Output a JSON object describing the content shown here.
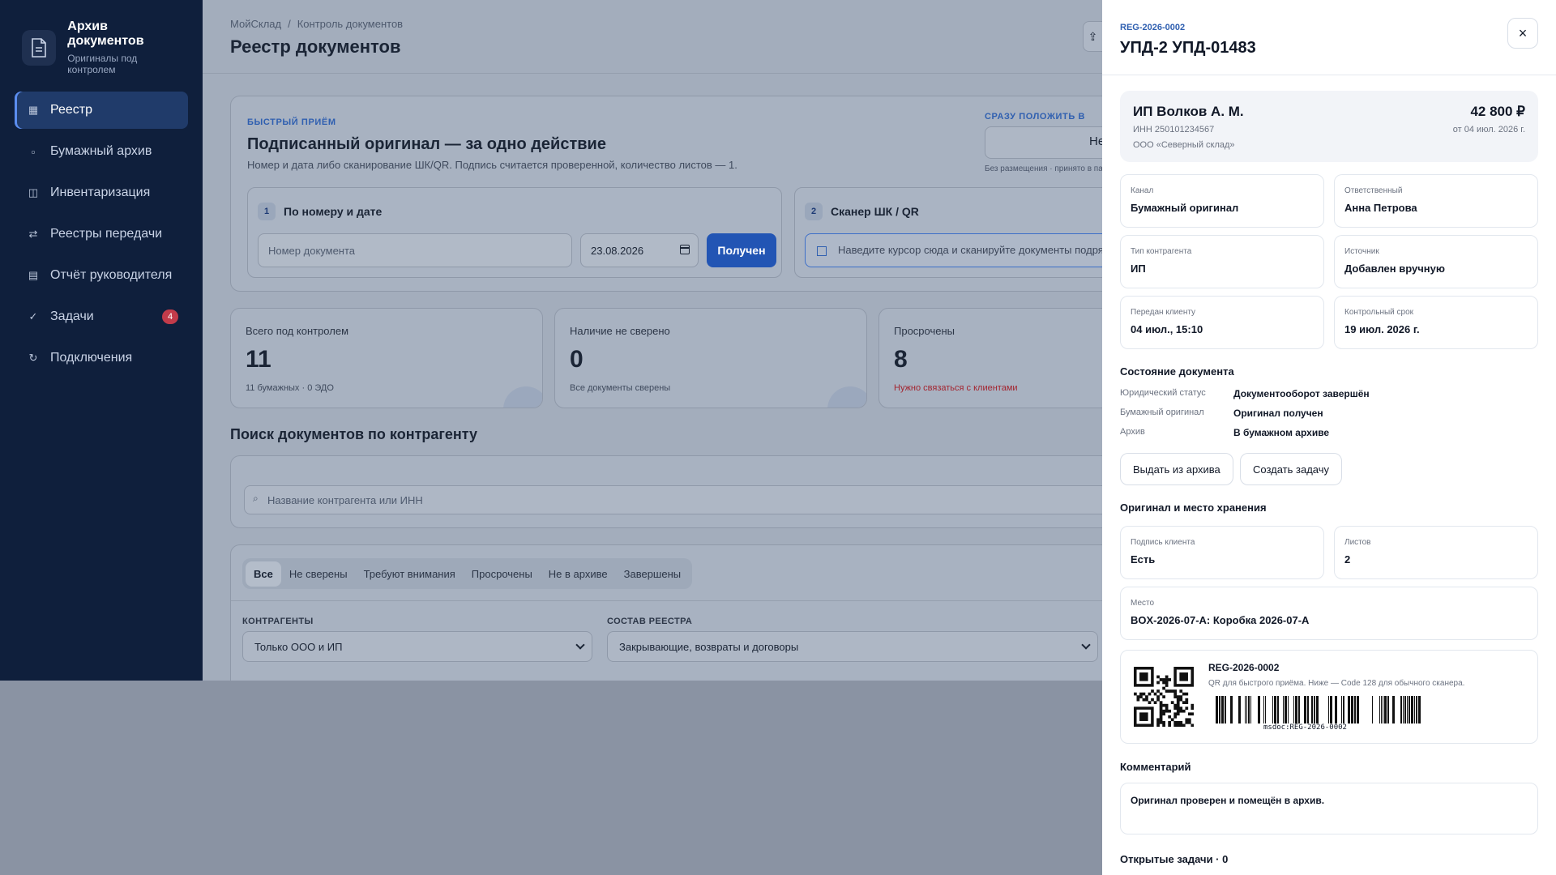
{
  "sidebar": {
    "brand_title": "Архив документов",
    "brand_subtitle": "Оригиналы под контролем",
    "items": [
      {
        "label": "Реестр",
        "icon": "grid-icon",
        "active": true
      },
      {
        "label": "Бумажный архив",
        "icon": "square-icon"
      },
      {
        "label": "Инвентаризация",
        "icon": "book-icon"
      },
      {
        "label": "Реестры передачи",
        "icon": "transfer-icon"
      },
      {
        "label": "Отчёт руководителя",
        "icon": "report-icon"
      },
      {
        "label": "Задачи",
        "icon": "check-icon",
        "badge": "4"
      },
      {
        "label": "Подключения",
        "icon": "refresh-icon"
      }
    ]
  },
  "main": {
    "breadcrumb": [
      "МойСклад",
      "Контроль документов"
    ],
    "title": "Реестр документов",
    "topbar_button": "⇪",
    "quick": {
      "kicker": "БЫСТРЫЙ ПРИЁМ",
      "title": "Подписанный оригинал — за одно действие",
      "description": "Номер и дата либо сканирование ШК/QR. Подпись считается проверенной, количество листов — 1.",
      "put_label": "СРАЗУ ПОЛОЖИТЬ В",
      "put_value": "Не",
      "put_hint": "Без размещения · принято в пап",
      "step1": {
        "num": "1",
        "title": "По номеру и дате",
        "placeholder": "Номер документа",
        "date": "23.08.2026",
        "button": "Получен"
      },
      "step2": {
        "num": "2",
        "title": "Сканер ШК / QR",
        "placeholder": "Наведите курсор сюда и сканируйте документы подря"
      }
    },
    "stats": [
      {
        "label": "Всего под контролем",
        "value": "11",
        "sub": "11 бумажных · 0 ЭДО",
        "warn": false
      },
      {
        "label": "Наличие не сверено",
        "value": "0",
        "sub": "Все документы сверены",
        "warn": false
      },
      {
        "label": "Просрочены",
        "value": "8",
        "sub": "Нужно связаться с клиентами",
        "warn": true
      }
    ],
    "search_title": "Поиск документов по контрагенту",
    "search_placeholder": "Название контрагента или ИНН",
    "tabs": [
      "Все",
      "Не сверены",
      "Требуют внимания",
      "Просрочены",
      "Не в архиве",
      "Завершены"
    ],
    "filters": {
      "contractors_label": "КОНТРАГЕНТЫ",
      "contractors_value": "Только ООО и ИП",
      "composition_label": "СОСТАВ РЕЕСТРА",
      "composition_value": "Закрывающие, возвраты и договоры"
    }
  },
  "drawer": {
    "code": "REG-2026-0002",
    "title": "УПД-2 УПД-01483",
    "close": "×",
    "summary": {
      "name": "ИП Волков А. М.",
      "inn": "ИНН 250101234567",
      "org": "ООО «Северный склад»",
      "amount": "42 800 ₽",
      "date": "от 04 июл. 2026 г."
    },
    "fields": [
      {
        "label": "Канал",
        "value": "Бумажный оригинал"
      },
      {
        "label": "Ответственный",
        "value": "Анна Петрова"
      },
      {
        "label": "Тип контрагента",
        "value": "ИП"
      },
      {
        "label": "Источник",
        "value": "Добавлен вручную"
      },
      {
        "label": "Передан клиенту",
        "value": "04 июл., 15:10"
      },
      {
        "label": "Контрольный срок",
        "value": "19 июл. 2026 г."
      }
    ],
    "state": {
      "title": "Состояние документа",
      "rows": [
        {
          "key": "Юридический статус",
          "value": "Документооборот завершён"
        },
        {
          "key": "Бумажный оригинал",
          "value": "Оригинал получен"
        },
        {
          "key": "Архив",
          "value": "В бумажном архиве"
        }
      ],
      "btn_issue": "Выдать из архива",
      "btn_task": "Создать задачу"
    },
    "storage": {
      "title": "Оригинал и место хранения",
      "signature_label": "Подпись клиента",
      "signature_value": "Есть",
      "sheets_label": "Листов",
      "sheets_value": "2",
      "place_label": "Место",
      "place_value": "BOX-2026-07-A: Коробка 2026-07-A"
    },
    "codes": {
      "id": "REG-2026-0002",
      "hint": "QR для быстрого приёма. Ниже — Code 128 для обычного сканера.",
      "barcode_text": "msdoc:REG-2026-0002"
    },
    "comment": {
      "title": "Комментарий",
      "text": "Оригинал проверен и помещён в архив."
    },
    "tasks_title": "Открытые задачи · 0"
  }
}
